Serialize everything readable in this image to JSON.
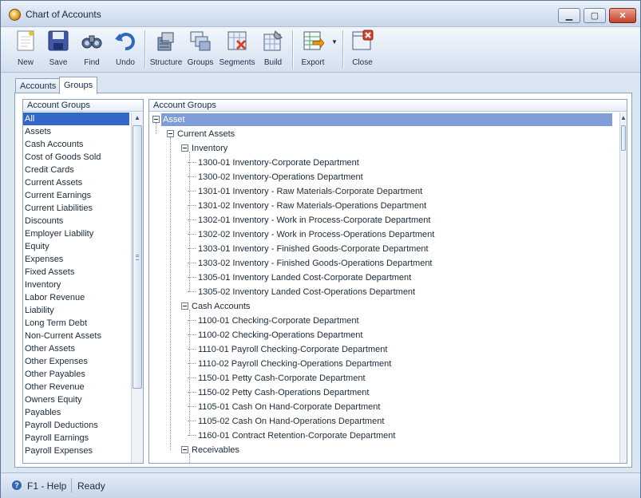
{
  "window": {
    "title": "Chart of Accounts"
  },
  "toolbar": {
    "new": "New",
    "save": "Save",
    "find": "Find",
    "undo": "Undo",
    "structure": "Structure",
    "groups": "Groups",
    "segments": "Segments",
    "build": "Build",
    "export": "Export",
    "close": "Close"
  },
  "tabs": [
    {
      "label": "Accounts"
    },
    {
      "label": "Groups"
    }
  ],
  "left_panel": {
    "header": "Account Groups",
    "items": [
      "All",
      "Assets",
      "Cash Accounts",
      "Cost of Goods Sold",
      "Credit Cards",
      "Current Assets",
      "Current Earnings",
      "Current Liabilities",
      "Discounts",
      "Employer Liability",
      "Equity",
      "Expenses",
      "Fixed Assets",
      "Inventory",
      "Labor Revenue",
      "Liability",
      "Long Term Debt",
      "Non-Current Assets",
      "Other Assets",
      "Other Expenses",
      "Other Payables",
      "Other Revenue",
      "Owners Equity",
      "Payables",
      "Payroll Deductions",
      "Payroll Earnings",
      "Payroll Expenses"
    ],
    "selected": "All"
  },
  "right_panel": {
    "header": "Account Groups",
    "tree": [
      {
        "label": "Asset",
        "level": 0,
        "expander": true,
        "selected": true
      },
      {
        "label": "Current Assets",
        "level": 1,
        "expander": true
      },
      {
        "label": "Inventory",
        "level": 2,
        "expander": true
      },
      {
        "label": "1300-01 Inventory-Corporate Department",
        "level": 3
      },
      {
        "label": "1300-02 Inventory-Operations Department",
        "level": 3
      },
      {
        "label": "1301-01 Inventory - Raw Materials-Corporate Department",
        "level": 3
      },
      {
        "label": "1301-02 Inventory - Raw Materials-Operations Department",
        "level": 3
      },
      {
        "label": "1302-01 Inventory - Work in Process-Corporate Department",
        "level": 3
      },
      {
        "label": "1302-02 Inventory - Work in Process-Operations Department",
        "level": 3
      },
      {
        "label": "1303-01 Inventory - Finished Goods-Corporate Department",
        "level": 3
      },
      {
        "label": "1303-02 Inventory - Finished Goods-Operations Department",
        "level": 3
      },
      {
        "label": "1305-01 Inventory Landed Cost-Corporate Department",
        "level": 3
      },
      {
        "label": "1305-02 Inventory Landed Cost-Operations Department",
        "level": 3
      },
      {
        "label": "Cash Accounts",
        "level": 2,
        "expander": true
      },
      {
        "label": "1100-01 Checking-Corporate Department",
        "level": 3
      },
      {
        "label": "1100-02 Checking-Operations Department",
        "level": 3
      },
      {
        "label": "1110-01 Payroll Checking-Corporate Department",
        "level": 3
      },
      {
        "label": "1110-02 Payroll Checking-Operations Department",
        "level": 3
      },
      {
        "label": "1150-01 Petty Cash-Corporate Department",
        "level": 3
      },
      {
        "label": "1150-02 Petty Cash-Operations Department",
        "level": 3
      },
      {
        "label": "1105-01 Cash On Hand-Corporate Department",
        "level": 3
      },
      {
        "label": "1105-02 Cash On Hand-Operations Department",
        "level": 3
      },
      {
        "label": "1160-01 Contract Retention-Corporate Department",
        "level": 3
      },
      {
        "label": "Receivables",
        "level": 2,
        "expander": true
      }
    ]
  },
  "status": {
    "help": "F1 - Help",
    "text": "Ready"
  },
  "colors": {
    "selection": "#3268c7",
    "tree_selection": "#7f9ed8",
    "chrome": "#dbe6f3"
  }
}
